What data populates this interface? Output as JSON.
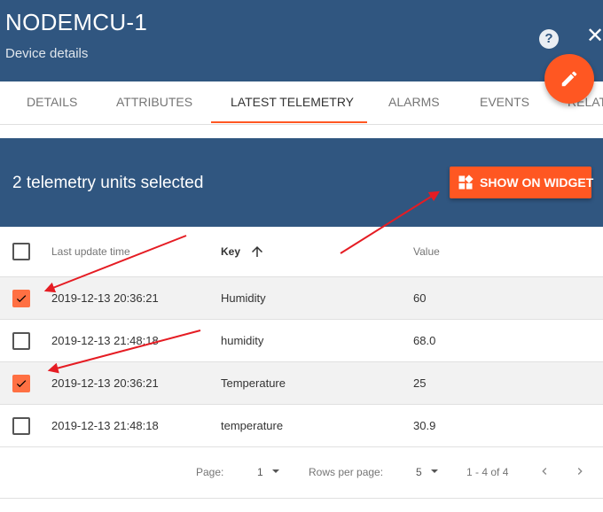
{
  "header": {
    "title": "NODEMCU-1",
    "subtitle": "Device details",
    "help_symbol": "?",
    "close_symbol": "✕"
  },
  "tabs": [
    {
      "label": "DETAILS"
    },
    {
      "label": "ATTRIBUTES"
    },
    {
      "label": "LATEST TELEMETRY"
    },
    {
      "label": "ALARMS"
    },
    {
      "label": "EVENTS"
    },
    {
      "label": "RELATIONS"
    }
  ],
  "active_tab": "LATEST TELEMETRY",
  "selection_bar": {
    "text": "2 telemetry units selected",
    "widget_button_label": "SHOW ON WIDGET"
  },
  "table": {
    "columns": {
      "time": "Last update time",
      "key": "Key",
      "value": "Value"
    },
    "sort_column": "Key",
    "sort_direction": "ascending",
    "rows": [
      {
        "time": "2019-12-13 20:36:21",
        "key": "Humidity",
        "value": "60",
        "checked": true
      },
      {
        "time": "2019-12-13 21:48:18",
        "key": "humidity",
        "value": "68.0",
        "checked": false
      },
      {
        "time": "2019-12-13 20:36:21",
        "key": "Temperature",
        "value": "25",
        "checked": true
      },
      {
        "time": "2019-12-13 21:48:18",
        "key": "temperature",
        "value": "30.9",
        "checked": false
      }
    ]
  },
  "paginator": {
    "page_label": "Page:",
    "page_value": "1",
    "rows_label": "Rows per page:",
    "rows_value": "5",
    "range": "1 - 4 of 4"
  },
  "colors": {
    "header": "#305680",
    "accent": "#ff5722",
    "arrow": "#e51c23"
  }
}
